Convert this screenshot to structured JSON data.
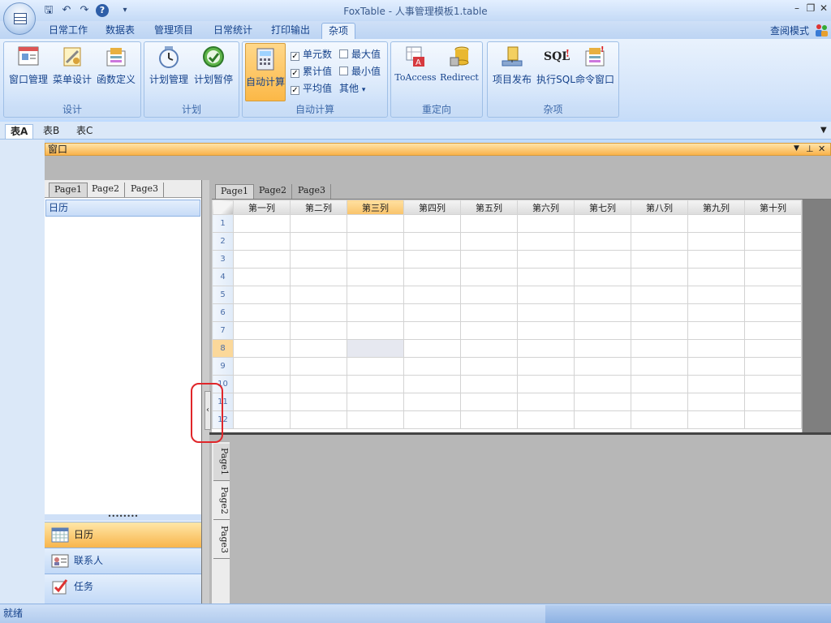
{
  "window": {
    "title": "FoxTable - 人事管理模板1.table"
  },
  "ribbon_tabs": [
    "日常工作",
    "数据表",
    "管理项目",
    "日常统计",
    "打印输出",
    "杂项"
  ],
  "active_tab": "杂项",
  "view_mode": "查阅模式",
  "groups": {
    "design": {
      "caption": "设计",
      "buttons": [
        "窗口管理",
        "菜单设计",
        "函数定义"
      ]
    },
    "plan": {
      "caption": "计划",
      "buttons": [
        "计划管理",
        "计划暂停"
      ]
    },
    "autocalc": {
      "caption": "自动计算",
      "button": "自动计算",
      "checks": [
        "单元数",
        "累计值",
        "平均值"
      ],
      "checks2": [
        "最大值",
        "最小值"
      ],
      "other": "其他"
    },
    "redirect": {
      "caption": "重定向",
      "buttons": [
        "ToAccess",
        "Redirect"
      ]
    },
    "misc": {
      "caption": "杂项",
      "buttons": [
        "项目发布",
        "执行SQL",
        "命令窗口"
      ],
      "sql_icon": "SQL"
    }
  },
  "doc_tabs": [
    "表A",
    "表B",
    "表C"
  ],
  "window_bar": {
    "title": "窗口"
  },
  "left_panel": {
    "tabs": [
      "Page1",
      "Page2",
      "Page3"
    ],
    "calendar_header": "日历",
    "nav": [
      "日历",
      "联系人",
      "任务"
    ]
  },
  "grid": {
    "tabs": [
      "Page1",
      "Page2",
      "Page3"
    ],
    "columns": [
      "第一列",
      "第二列",
      "第三列",
      "第四列",
      "第五列",
      "第六列",
      "第七列",
      "第八列",
      "第九列",
      "第十列"
    ],
    "rows": [
      "1",
      "2",
      "3",
      "4",
      "5",
      "6",
      "7",
      "8",
      "9",
      "10",
      "11",
      "12"
    ],
    "selected_column": "第三列",
    "selected_row": "8"
  },
  "bottom_tabs": [
    "Page1",
    "Page2",
    "Page3"
  ],
  "status": {
    "text": "就绪"
  },
  "colors": {
    "accent": "#f9b24a",
    "ribbon": "#d3e4fa",
    "highlight_ring": "#e0262a"
  }
}
